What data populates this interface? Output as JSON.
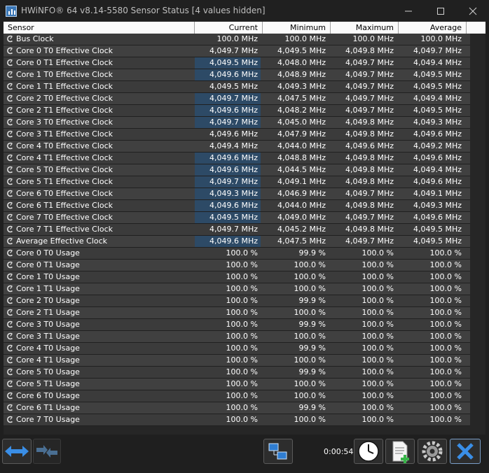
{
  "window": {
    "title": "HWiNFO® 64 v8.14-5580 Sensor Status [4 values hidden]"
  },
  "columns": [
    "Sensor",
    "Current",
    "Minimum",
    "Maximum",
    "Average"
  ],
  "rows": [
    {
      "name": "Bus Clock",
      "current": "100.0 MHz",
      "minimum": "100.0 MHz",
      "maximum": "100.0 MHz",
      "average": "100.0 MHz",
      "level": 0
    },
    {
      "name": "Core 0 T0 Effective Clock",
      "current": "4,049.7 MHz",
      "minimum": "4,049.5 MHz",
      "maximum": "4,049.8 MHz",
      "average": "4,049.7 MHz",
      "level": 0
    },
    {
      "name": "Core 0 T1 Effective Clock",
      "current": "4,049.5 MHz",
      "minimum": "4,048.0 MHz",
      "maximum": "4,049.7 MHz",
      "average": "4,049.4 MHz",
      "level": 0.97
    },
    {
      "name": "Core 1 T0 Effective Clock",
      "current": "4,049.6 MHz",
      "minimum": "4,048.9 MHz",
      "maximum": "4,049.7 MHz",
      "average": "4,049.5 MHz",
      "level": 0.97
    },
    {
      "name": "Core 1 T1 Effective Clock",
      "current": "4,049.5 MHz",
      "minimum": "4,049.3 MHz",
      "maximum": "4,049.7 MHz",
      "average": "4,049.5 MHz",
      "level": 0
    },
    {
      "name": "Core 2 T0 Effective Clock",
      "current": "4,049.7 MHz",
      "minimum": "4,047.5 MHz",
      "maximum": "4,049.7 MHz",
      "average": "4,049.4 MHz",
      "level": 0.97
    },
    {
      "name": "Core 2 T1 Effective Clock",
      "current": "4,049.6 MHz",
      "minimum": "4,048.2 MHz",
      "maximum": "4,049.7 MHz",
      "average": "4,049.5 MHz",
      "level": 0.97
    },
    {
      "name": "Core 3 T0 Effective Clock",
      "current": "4,049.7 MHz",
      "minimum": "4,045.0 MHz",
      "maximum": "4,049.8 MHz",
      "average": "4,049.3 MHz",
      "level": 0.97
    },
    {
      "name": "Core 3 T1 Effective Clock",
      "current": "4,049.6 MHz",
      "minimum": "4,047.9 MHz",
      "maximum": "4,049.8 MHz",
      "average": "4,049.6 MHz",
      "level": 0
    },
    {
      "name": "Core 4 T0 Effective Clock",
      "current": "4,049.4 MHz",
      "minimum": "4,044.0 MHz",
      "maximum": "4,049.6 MHz",
      "average": "4,049.2 MHz",
      "level": 0
    },
    {
      "name": "Core 4 T1 Effective Clock",
      "current": "4,049.6 MHz",
      "minimum": "4,048.8 MHz",
      "maximum": "4,049.8 MHz",
      "average": "4,049.6 MHz",
      "level": 0.97
    },
    {
      "name": "Core 5 T0 Effective Clock",
      "current": "4,049.6 MHz",
      "minimum": "4,044.5 MHz",
      "maximum": "4,049.8 MHz",
      "average": "4,049.4 MHz",
      "level": 0.97
    },
    {
      "name": "Core 5 T1 Effective Clock",
      "current": "4,049.7 MHz",
      "minimum": "4,049.1 MHz",
      "maximum": "4,049.8 MHz",
      "average": "4,049.6 MHz",
      "level": 0.97
    },
    {
      "name": "Core 6 T0 Effective Clock",
      "current": "4,049.3 MHz",
      "minimum": "4,046.9 MHz",
      "maximum": "4,049.7 MHz",
      "average": "4,049.1 MHz",
      "level": 0.97
    },
    {
      "name": "Core 6 T1 Effective Clock",
      "current": "4,049.6 MHz",
      "minimum": "4,044.0 MHz",
      "maximum": "4,049.8 MHz",
      "average": "4,049.3 MHz",
      "level": 0.97
    },
    {
      "name": "Core 7 T0 Effective Clock",
      "current": "4,049.5 MHz",
      "minimum": "4,049.0 MHz",
      "maximum": "4,049.7 MHz",
      "average": "4,049.6 MHz",
      "level": 0.97
    },
    {
      "name": "Core 7 T1 Effective Clock",
      "current": "4,049.7 MHz",
      "minimum": "4,045.2 MHz",
      "maximum": "4,049.8 MHz",
      "average": "4,049.5 MHz",
      "level": 0
    },
    {
      "name": "Average Effective Clock",
      "current": "4,049.6 MHz",
      "minimum": "4,047.5 MHz",
      "maximum": "4,049.7 MHz",
      "average": "4,049.5 MHz",
      "level": 0.97
    },
    {
      "name": "Core 0 T0 Usage",
      "current": "100.0 %",
      "minimum": "99.9 %",
      "maximum": "100.0 %",
      "average": "100.0 %",
      "level": 0
    },
    {
      "name": "Core 0 T1 Usage",
      "current": "100.0 %",
      "minimum": "100.0 %",
      "maximum": "100.0 %",
      "average": "100.0 %",
      "level": 0
    },
    {
      "name": "Core 1 T0 Usage",
      "current": "100.0 %",
      "minimum": "100.0 %",
      "maximum": "100.0 %",
      "average": "100.0 %",
      "level": 0
    },
    {
      "name": "Core 1 T1 Usage",
      "current": "100.0 %",
      "minimum": "100.0 %",
      "maximum": "100.0 %",
      "average": "100.0 %",
      "level": 0
    },
    {
      "name": "Core 2 T0 Usage",
      "current": "100.0 %",
      "minimum": "99.9 %",
      "maximum": "100.0 %",
      "average": "100.0 %",
      "level": 0
    },
    {
      "name": "Core 2 T1 Usage",
      "current": "100.0 %",
      "minimum": "100.0 %",
      "maximum": "100.0 %",
      "average": "100.0 %",
      "level": 0
    },
    {
      "name": "Core 3 T0 Usage",
      "current": "100.0 %",
      "minimum": "99.9 %",
      "maximum": "100.0 %",
      "average": "100.0 %",
      "level": 0
    },
    {
      "name": "Core 3 T1 Usage",
      "current": "100.0 %",
      "minimum": "100.0 %",
      "maximum": "100.0 %",
      "average": "100.0 %",
      "level": 0
    },
    {
      "name": "Core 4 T0 Usage",
      "current": "100.0 %",
      "minimum": "99.9 %",
      "maximum": "100.0 %",
      "average": "100.0 %",
      "level": 0
    },
    {
      "name": "Core 4 T1 Usage",
      "current": "100.0 %",
      "minimum": "100.0 %",
      "maximum": "100.0 %",
      "average": "100.0 %",
      "level": 0
    },
    {
      "name": "Core 5 T0 Usage",
      "current": "100.0 %",
      "minimum": "99.9 %",
      "maximum": "100.0 %",
      "average": "100.0 %",
      "level": 0
    },
    {
      "name": "Core 5 T1 Usage",
      "current": "100.0 %",
      "minimum": "100.0 %",
      "maximum": "100.0 %",
      "average": "100.0 %",
      "level": 0
    },
    {
      "name": "Core 6 T0 Usage",
      "current": "100.0 %",
      "minimum": "100.0 %",
      "maximum": "100.0 %",
      "average": "100.0 %",
      "level": 0
    },
    {
      "name": "Core 6 T1 Usage",
      "current": "100.0 %",
      "minimum": "99.9 %",
      "maximum": "100.0 %",
      "average": "100.0 %",
      "level": 0
    },
    {
      "name": "Core 7 T0 Usage",
      "current": "100.0 %",
      "minimum": "100.0 %",
      "maximum": "100.0 %",
      "average": "100.0 %",
      "level": 0
    }
  ],
  "status": {
    "timer": "0:00:54"
  },
  "icons": {
    "nav": "arrows-icon",
    "swap": "swap-arrows-icon",
    "network": "network-icon",
    "clock": "clock-icon",
    "report": "report-add-icon",
    "settings": "gear-icon",
    "close": "close-icon"
  },
  "colors": {
    "bar": "#2d4a66",
    "accent": "#3a77b7"
  }
}
